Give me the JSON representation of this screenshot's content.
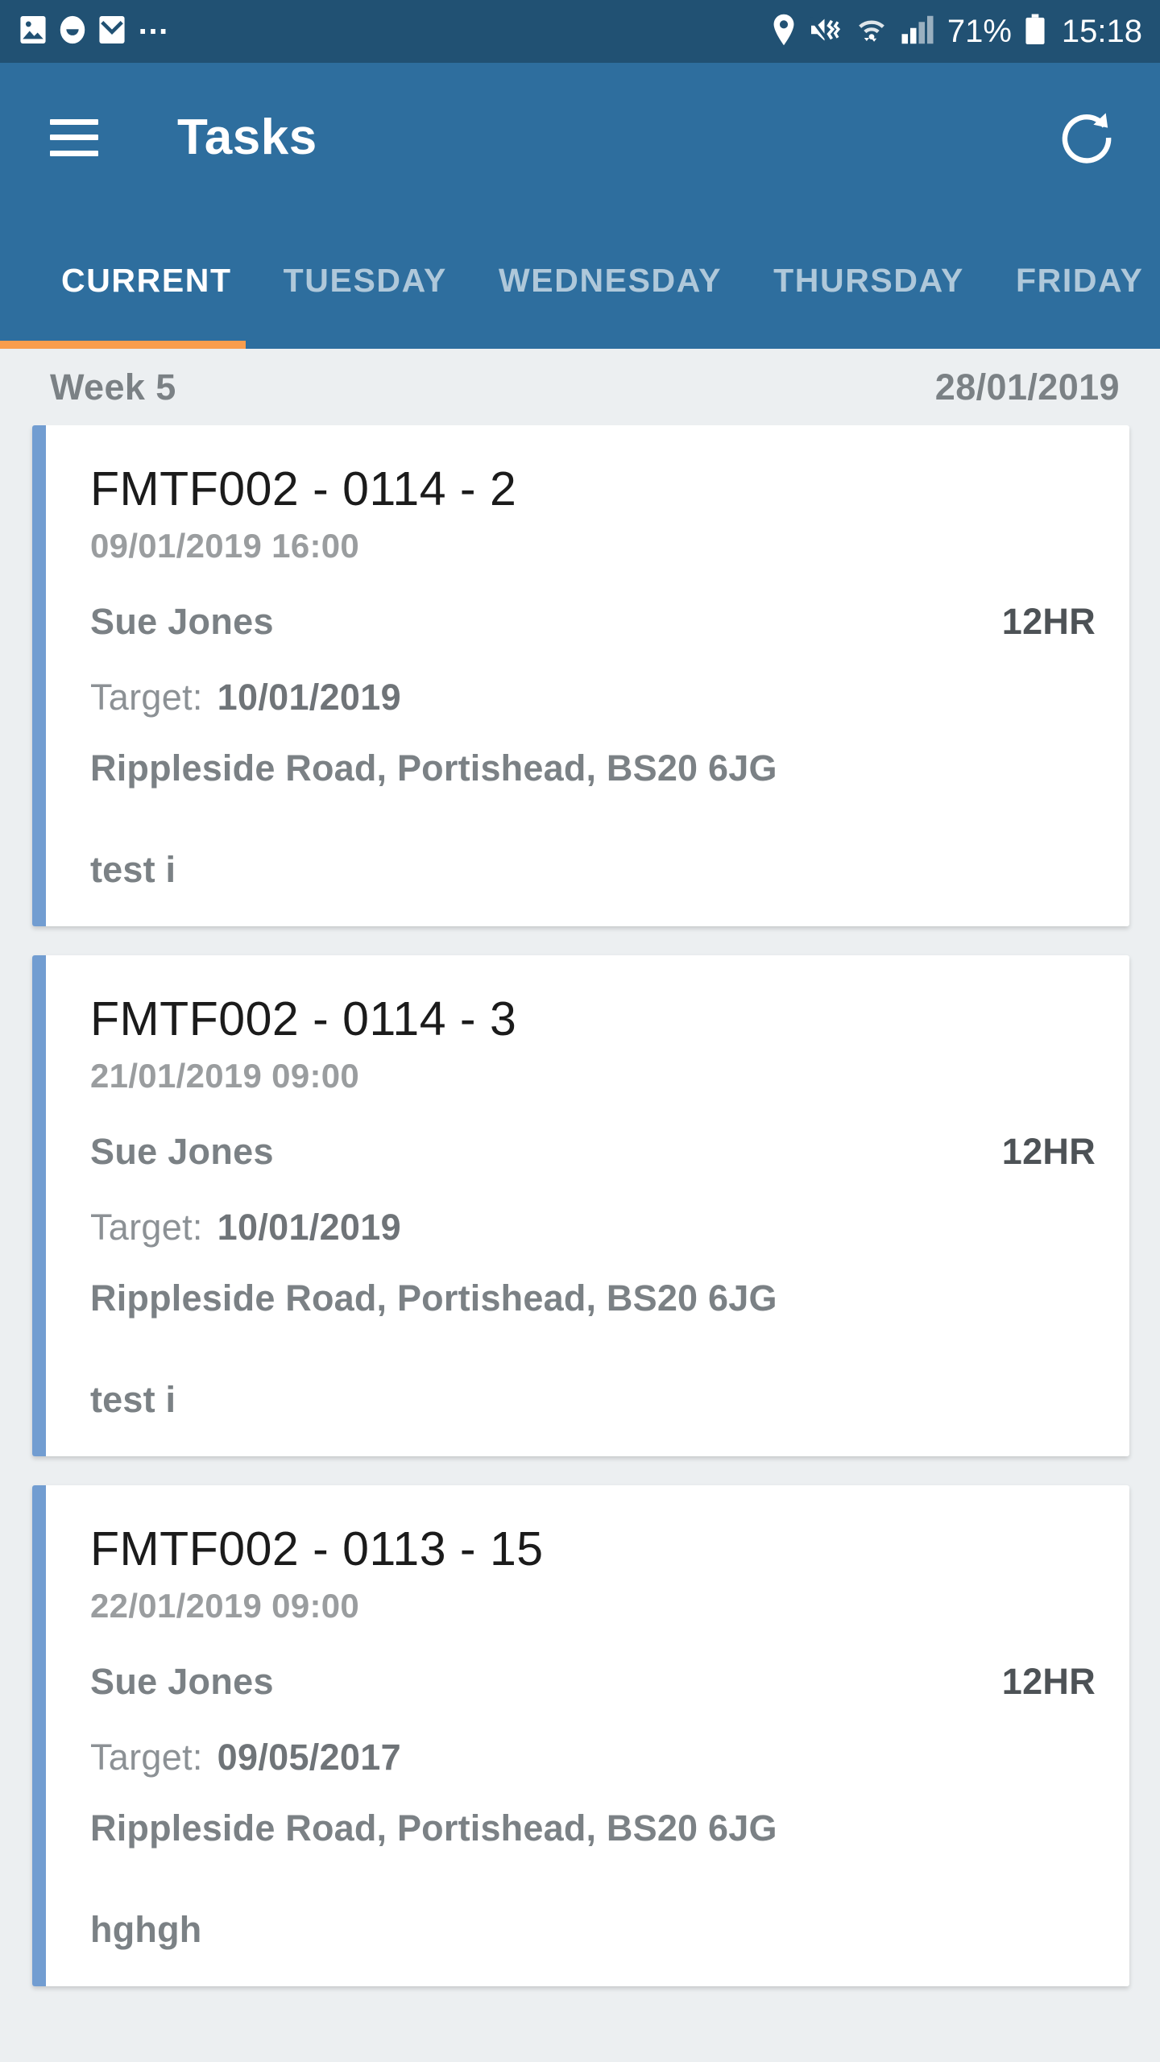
{
  "statusbar": {
    "left_icons": [
      "image-icon",
      "smiley-icon",
      "mail-icon"
    ],
    "overflow": "…",
    "right_icons": [
      "location-icon",
      "mute-vibrate-icon",
      "wifi-icon",
      "signal-icon",
      "battery-icon"
    ],
    "battery_percent": "71%",
    "clock": "15:18"
  },
  "appbar": {
    "menu_icon": "hamburger-icon",
    "title": "Tasks",
    "refresh_icon": "refresh-icon"
  },
  "tabs": {
    "items": [
      {
        "label": "CURRENT",
        "active": true
      },
      {
        "label": "TUESDAY",
        "active": false
      },
      {
        "label": "WEDNESDAY",
        "active": false
      },
      {
        "label": "THURSDAY",
        "active": false
      },
      {
        "label": "FRIDAY",
        "active": false
      }
    ],
    "indicator_color": "#f99d4d"
  },
  "week_header": {
    "week_label": "Week 5",
    "date": "28/01/2019"
  },
  "colors": {
    "statusbar_bg": "#215173",
    "appbar_bg": "#2e6e9e",
    "page_bg": "#eceff1",
    "card_accent": "#729dd1",
    "tab_indicator": "#f99d4d"
  },
  "labels": {
    "target_label": "Target:"
  },
  "tasks": [
    {
      "title": "FMTF002 - 0114 - 2",
      "datetime": "09/01/2019 16:00",
      "person": "Sue Jones",
      "duration": "12HR",
      "target": "10/01/2019",
      "address": "Rippleside Road, Portishead, BS20 6JG",
      "note": "test i"
    },
    {
      "title": "FMTF002 - 0114 - 3",
      "datetime": "21/01/2019 09:00",
      "person": "Sue Jones",
      "duration": "12HR",
      "target": "10/01/2019",
      "address": "Rippleside Road, Portishead, BS20 6JG",
      "note": "test i"
    },
    {
      "title": "FMTF002 - 0113 - 15",
      "datetime": "22/01/2019 09:00",
      "person": "Sue Jones",
      "duration": "12HR",
      "target": "09/05/2017",
      "address": "Rippleside Road, Portishead, BS20 6JG",
      "note": "hghgh"
    }
  ]
}
